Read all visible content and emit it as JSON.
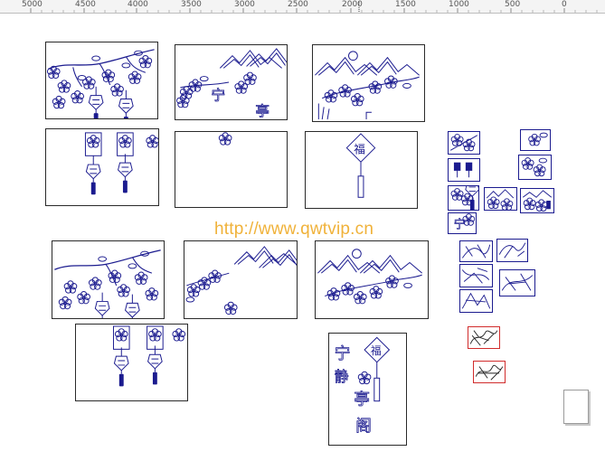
{
  "ruler": {
    "labels": [
      "5000",
      "4500",
      "4000",
      "3500",
      "3000",
      "2500",
      "2000",
      "1500",
      "1000",
      "500",
      "0"
    ]
  },
  "watermark": {
    "text": "http://www.qwtvip.cn"
  },
  "colors": {
    "line_art": "#1b1b8f",
    "frame": "#2a2a2a",
    "watermark": "#f0b23a",
    "red_outline": "#d12c2c"
  },
  "icons": {
    "blossom": "plum-blossom-icon",
    "knot": "chinese-knot-icon",
    "mountain": "mountain-icon",
    "page": "page-icon"
  }
}
